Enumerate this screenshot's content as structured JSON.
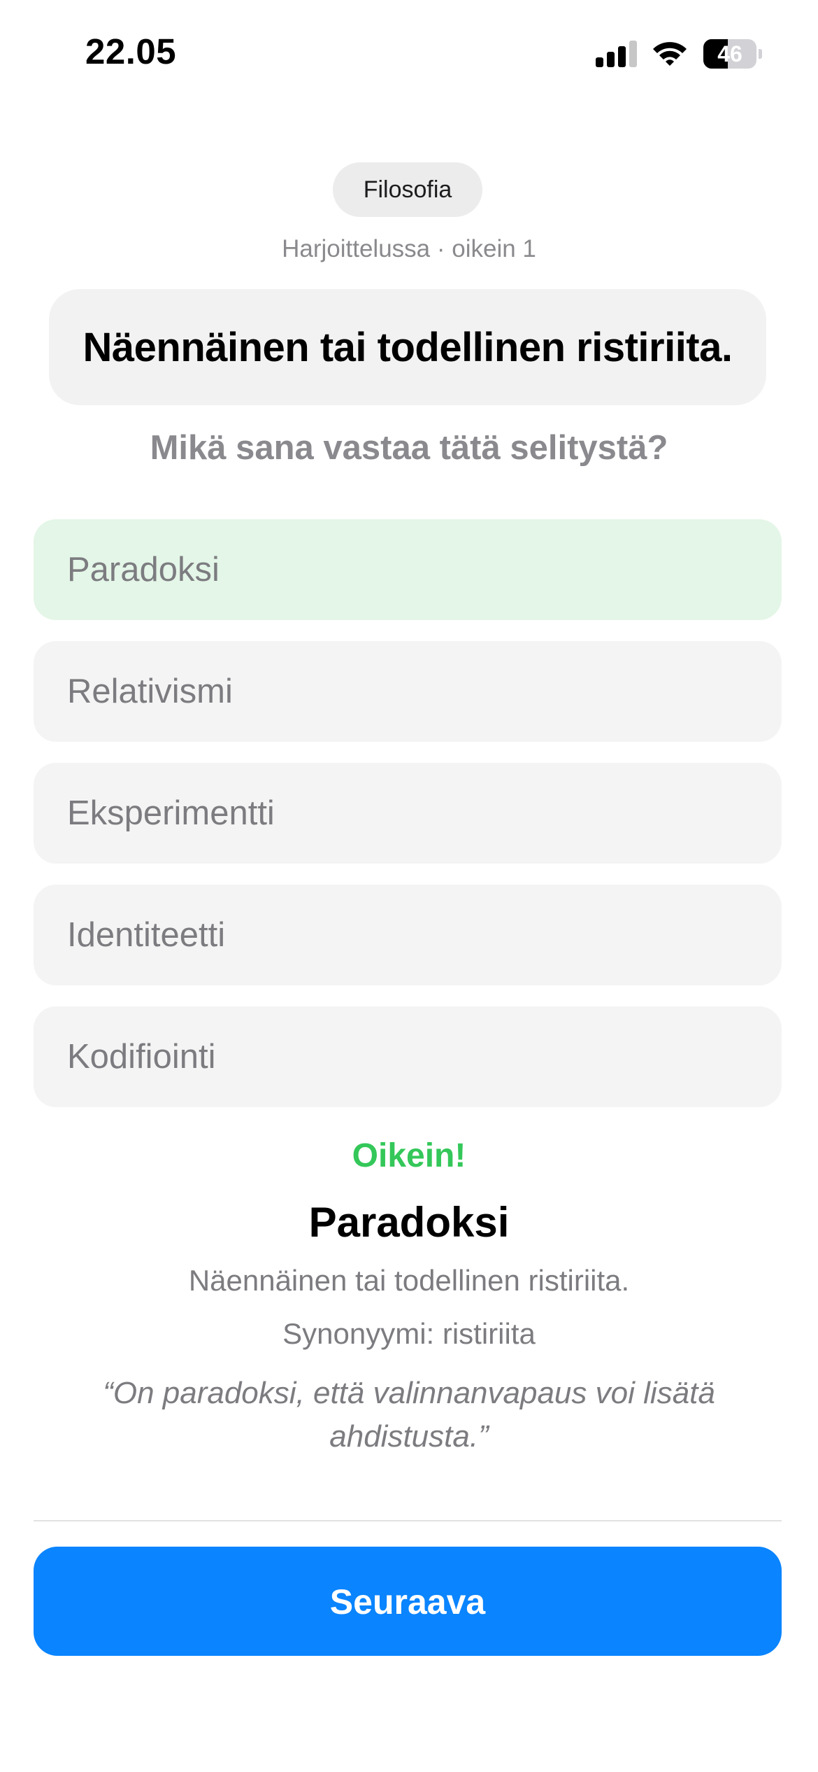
{
  "status_bar": {
    "time": "22.05",
    "battery_percent": "46",
    "battery_level": 0.46,
    "icons": [
      "signal-icon",
      "wifi-icon",
      "battery-icon"
    ]
  },
  "quiz": {
    "category": "Filosofia",
    "progress": "Harjoittelussa · oikein 1",
    "definition": "Näennäinen tai todellinen ristiriita.",
    "question": "Mikä sana vastaa tätä selitystä?",
    "options": [
      {
        "label": "Paradoksi",
        "state": "correct"
      },
      {
        "label": "Relativismi",
        "state": "default"
      },
      {
        "label": "Eksperimentti",
        "state": "default"
      },
      {
        "label": "Identiteetti",
        "state": "default"
      },
      {
        "label": "Kodifiointi",
        "state": "default"
      }
    ]
  },
  "feedback": {
    "status": "Oikein!",
    "word": "Paradoksi",
    "definition": "Näennäinen tai todellinen ristiriita.",
    "synonym": "Synonyymi: ristiriita",
    "example": "“On paradoksi, että valinnanvapaus voi lisätä ahdistusta.”"
  },
  "actions": {
    "next_label": "Seuraava"
  },
  "colors": {
    "accent": "#0a84ff",
    "correct_text": "#34c759",
    "correct_bg": "#e4f6e7",
    "option_bg": "#f4f4f4"
  }
}
